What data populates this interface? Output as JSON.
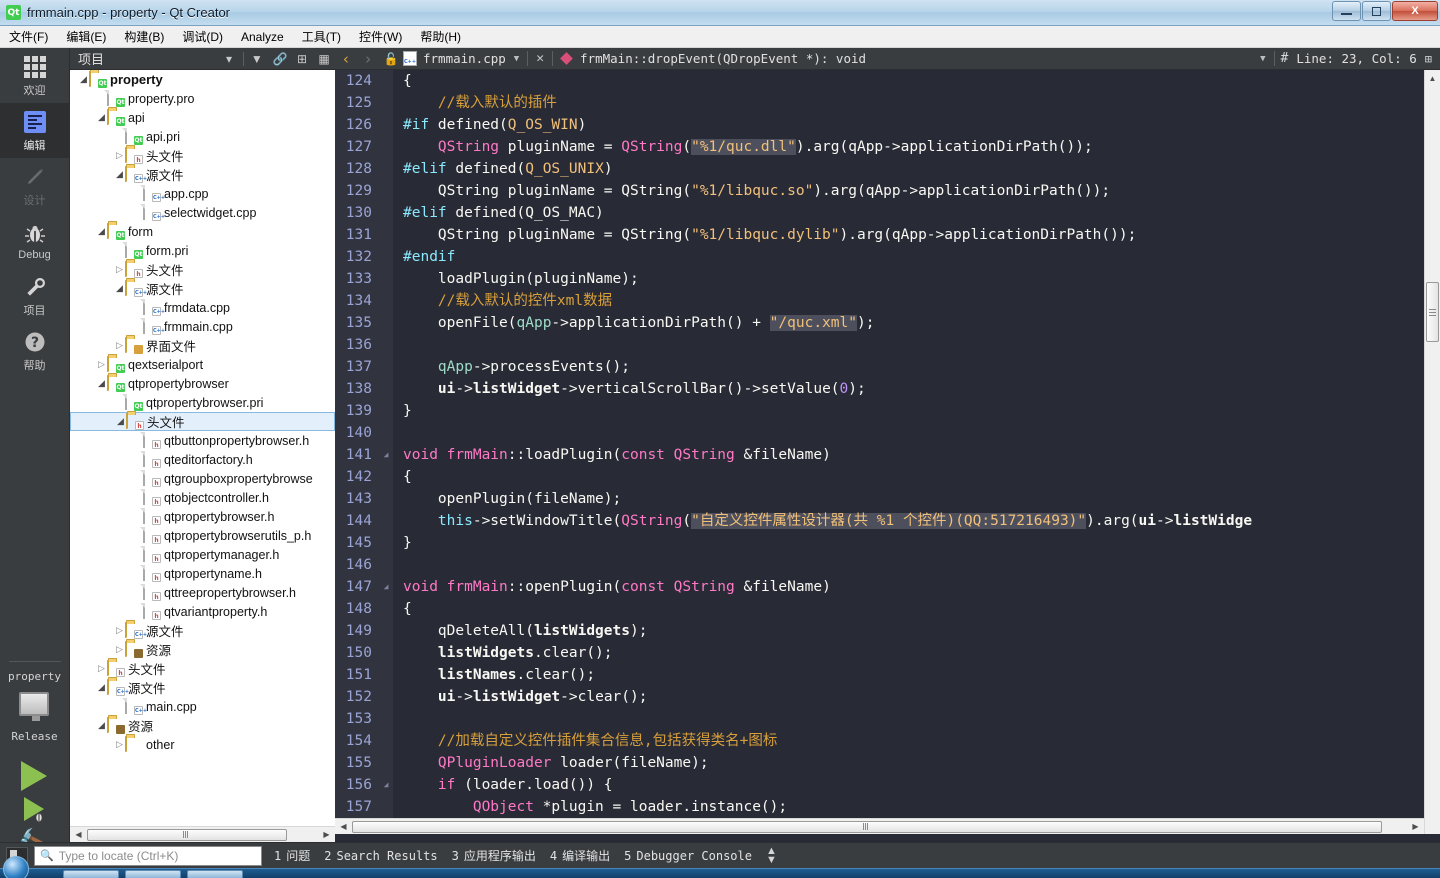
{
  "window": {
    "title": "frmmain.cpp - property - Qt Creator",
    "logo_text": "Qt",
    "minimize_label": "Minimize",
    "maximize_label": "Restore",
    "close_label": "X"
  },
  "menubar": {
    "items": [
      {
        "label": "文件(F)"
      },
      {
        "label": "编辑(E)"
      },
      {
        "label": "构建(B)"
      },
      {
        "label": "调试(D)"
      },
      {
        "label": "Analyze"
      },
      {
        "label": "工具(T)"
      },
      {
        "label": "控件(W)"
      },
      {
        "label": "帮助(H)"
      }
    ]
  },
  "modebar": {
    "modes": [
      {
        "label": "欢迎",
        "icon": "grid-icon",
        "state": "normal"
      },
      {
        "label": "编辑",
        "icon": "document-lines-icon",
        "state": "active"
      },
      {
        "label": "设计",
        "icon": "pencil-icon",
        "state": "disabled"
      },
      {
        "label": "Debug",
        "icon": "bug-icon",
        "state": "normal"
      },
      {
        "label": "项目",
        "icon": "wrench-icon",
        "state": "normal"
      },
      {
        "label": "帮助",
        "icon": "question-mark-icon",
        "state": "normal"
      }
    ],
    "kit": {
      "project": "property",
      "build_config": "Release",
      "run_label": "Run",
      "debug_label": "Start Debugging",
      "build_label": "Build"
    }
  },
  "project_panel": {
    "title": "项目",
    "toolbar": [
      {
        "name": "filter-icon",
        "glyph": "▼"
      },
      {
        "name": "sync-link-icon",
        "glyph": "⎆"
      },
      {
        "name": "split-icon",
        "glyph": "⊞"
      },
      {
        "name": "close-sidebar-icon",
        "glyph": "◧"
      }
    ],
    "tree": [
      {
        "label": "property",
        "depth": 0,
        "arrow": "open",
        "icon": "folder-qt",
        "bold": true
      },
      {
        "label": "property.pro",
        "depth": 1,
        "arrow": "none",
        "icon": "doc-qt"
      },
      {
        "label": "api",
        "depth": 1,
        "arrow": "open",
        "icon": "folder-qt"
      },
      {
        "label": "api.pri",
        "depth": 2,
        "arrow": "none",
        "icon": "doc-qt"
      },
      {
        "label": "头文件",
        "depth": 2,
        "arrow": "closed",
        "icon": "folder-h"
      },
      {
        "label": "源文件",
        "depth": 2,
        "arrow": "open",
        "icon": "folder-cpp"
      },
      {
        "label": "app.cpp",
        "depth": 3,
        "arrow": "none",
        "icon": "doc-cpp"
      },
      {
        "label": "selectwidget.cpp",
        "depth": 3,
        "arrow": "none",
        "icon": "doc-cpp"
      },
      {
        "label": "form",
        "depth": 1,
        "arrow": "open",
        "icon": "folder-qt"
      },
      {
        "label": "form.pri",
        "depth": 2,
        "arrow": "none",
        "icon": "doc-qt"
      },
      {
        "label": "头文件",
        "depth": 2,
        "arrow": "closed",
        "icon": "folder-h"
      },
      {
        "label": "源文件",
        "depth": 2,
        "arrow": "open",
        "icon": "folder-cpp"
      },
      {
        "label": "frmdata.cpp",
        "depth": 3,
        "arrow": "none",
        "icon": "doc-cpp"
      },
      {
        "label": "frmmain.cpp",
        "depth": 3,
        "arrow": "none",
        "icon": "doc-cpp"
      },
      {
        "label": "界面文件",
        "depth": 2,
        "arrow": "closed",
        "icon": "folder-ui"
      },
      {
        "label": "qextserialport",
        "depth": 1,
        "arrow": "closed",
        "icon": "folder-qt"
      },
      {
        "label": "qtpropertybrowser",
        "depth": 1,
        "arrow": "open",
        "icon": "folder-qt"
      },
      {
        "label": "qtpropertybrowser.pri",
        "depth": 2,
        "arrow": "none",
        "icon": "doc-qt"
      },
      {
        "label": "头文件",
        "depth": 2,
        "arrow": "open",
        "icon": "folder-h",
        "selected": true
      },
      {
        "label": "qtbuttonpropertybrowser.h",
        "depth": 3,
        "arrow": "none",
        "icon": "doc-h"
      },
      {
        "label": "qteditorfactory.h",
        "depth": 3,
        "arrow": "none",
        "icon": "doc-h"
      },
      {
        "label": "qtgroupboxpropertybrowse",
        "depth": 3,
        "arrow": "none",
        "icon": "doc-h"
      },
      {
        "label": "qtobjectcontroller.h",
        "depth": 3,
        "arrow": "none",
        "icon": "doc-h"
      },
      {
        "label": "qtpropertybrowser.h",
        "depth": 3,
        "arrow": "none",
        "icon": "doc-h"
      },
      {
        "label": "qtpropertybrowserutils_p.h",
        "depth": 3,
        "arrow": "none",
        "icon": "doc-h"
      },
      {
        "label": "qtpropertymanager.h",
        "depth": 3,
        "arrow": "none",
        "icon": "doc-h"
      },
      {
        "label": "qtpropertyname.h",
        "depth": 3,
        "arrow": "none",
        "icon": "doc-h"
      },
      {
        "label": "qttreepropertybrowser.h",
        "depth": 3,
        "arrow": "none",
        "icon": "doc-h"
      },
      {
        "label": "qtvariantproperty.h",
        "depth": 3,
        "arrow": "none",
        "icon": "doc-h"
      },
      {
        "label": "源文件",
        "depth": 2,
        "arrow": "closed",
        "icon": "folder-cpp"
      },
      {
        "label": "资源",
        "depth": 2,
        "arrow": "closed",
        "icon": "folder-res"
      },
      {
        "label": "头文件",
        "depth": 1,
        "arrow": "closed",
        "icon": "folder-h"
      },
      {
        "label": "源文件",
        "depth": 1,
        "arrow": "open",
        "icon": "folder-cpp"
      },
      {
        "label": "main.cpp",
        "depth": 2,
        "arrow": "none",
        "icon": "doc-cpp"
      },
      {
        "label": "资源",
        "depth": 1,
        "arrow": "open",
        "icon": "folder-res"
      },
      {
        "label": "other",
        "depth": 2,
        "arrow": "closed",
        "icon": "folder-plain"
      }
    ]
  },
  "editor": {
    "toolbar": {
      "back_glyph": "‹",
      "forward_glyph": "›",
      "lock_label": "unlocked",
      "filename": "frmmain.cpp",
      "close_glyph": "✕",
      "symbol": "frmMain::dropEvent(QDropEvent *): void",
      "line_col": "Line: 23, Col: 6",
      "hash_glyph": "#",
      "split_glyph": "⊞"
    },
    "first_line": 124,
    "lines": [
      {
        "n": 124,
        "fold": false,
        "tokens": [
          {
            "t": "{",
            "c": "fn"
          }
        ]
      },
      {
        "n": 125,
        "fold": false,
        "tokens": [
          {
            "t": "    //载入默认的插件",
            "c": "cmt"
          }
        ]
      },
      {
        "n": 126,
        "fold": false,
        "tokens": [
          {
            "t": "#if",
            "c": "pre"
          },
          {
            "t": " defined(",
            "c": "fn"
          },
          {
            "t": "Q_OS_WIN",
            "c": "str"
          },
          {
            "t": ")",
            "c": "fn"
          }
        ]
      },
      {
        "n": 127,
        "fold": false,
        "tokens": [
          {
            "t": "    ",
            "c": "fn"
          },
          {
            "t": "QString",
            "c": "kw"
          },
          {
            "t": " pluginName = ",
            "c": "fn"
          },
          {
            "t": "QString",
            "c": "kw"
          },
          {
            "t": "(",
            "c": "fn"
          },
          {
            "t": "\"%1/quc.dll\"",
            "c": "strh"
          },
          {
            "t": ").arg(qApp->applicationDirPath());",
            "c": "fn"
          }
        ]
      },
      {
        "n": 128,
        "fold": false,
        "tokens": [
          {
            "t": "#elif",
            "c": "pre"
          },
          {
            "t": " defined(",
            "c": "fn"
          },
          {
            "t": "Q_OS_UNIX",
            "c": "str"
          },
          {
            "t": ")",
            "c": "fn"
          }
        ]
      },
      {
        "n": 129,
        "fold": false,
        "tokens": [
          {
            "t": "    QString pluginName = QString(",
            "c": "fn"
          },
          {
            "t": "\"%1/libquc.so\"",
            "c": "str"
          },
          {
            "t": ").arg(qApp->applicationDirPath());",
            "c": "fn"
          }
        ]
      },
      {
        "n": 130,
        "fold": false,
        "tokens": [
          {
            "t": "#elif",
            "c": "pre"
          },
          {
            "t": " defined(Q_OS_MAC)",
            "c": "fn"
          }
        ]
      },
      {
        "n": 131,
        "fold": false,
        "tokens": [
          {
            "t": "    QString pluginName = QString(",
            "c": "fn"
          },
          {
            "t": "\"%1/libquc.dylib\"",
            "c": "str"
          },
          {
            "t": ").arg(qApp->applicationDirPath());",
            "c": "fn"
          }
        ]
      },
      {
        "n": 132,
        "fold": false,
        "tokens": [
          {
            "t": "#endif",
            "c": "pre"
          }
        ]
      },
      {
        "n": 133,
        "fold": false,
        "tokens": [
          {
            "t": "    loadPlugin(pluginName);",
            "c": "fn"
          }
        ]
      },
      {
        "n": 134,
        "fold": false,
        "tokens": [
          {
            "t": "    //载入默认的控件xml数据",
            "c": "cmt"
          }
        ]
      },
      {
        "n": 135,
        "fold": false,
        "tokens": [
          {
            "t": "    openFile(",
            "c": "fn"
          },
          {
            "t": "qApp",
            "c": "var"
          },
          {
            "t": "->applicationDirPath() + ",
            "c": "fn"
          },
          {
            "t": "\"/quc.xml\"",
            "c": "strh"
          },
          {
            "t": ");",
            "c": "fn"
          }
        ]
      },
      {
        "n": 136,
        "fold": false,
        "tokens": []
      },
      {
        "n": 137,
        "fold": false,
        "tokens": [
          {
            "t": "    ",
            "c": "fn"
          },
          {
            "t": "qApp",
            "c": "var"
          },
          {
            "t": "->processEvents();",
            "c": "fn"
          }
        ]
      },
      {
        "n": 138,
        "fold": false,
        "tokens": [
          {
            "t": "    ",
            "c": "fn"
          },
          {
            "t": "ui",
            "c": "bld"
          },
          {
            "t": "->",
            "c": "fn"
          },
          {
            "t": "listWidget",
            "c": "bld"
          },
          {
            "t": "->verticalScrollBar()->setValue(",
            "c": "fn"
          },
          {
            "t": "0",
            "c": "num"
          },
          {
            "t": ");",
            "c": "fn"
          }
        ]
      },
      {
        "n": 139,
        "fold": false,
        "tokens": [
          {
            "t": "}",
            "c": "fn"
          }
        ]
      },
      {
        "n": 140,
        "fold": false,
        "tokens": []
      },
      {
        "n": 141,
        "fold": true,
        "tokens": [
          {
            "t": "void",
            "c": "kw"
          },
          {
            "t": " ",
            "c": "fn"
          },
          {
            "t": "frmMain",
            "c": "kw"
          },
          {
            "t": "::loadPlugin(",
            "c": "fn"
          },
          {
            "t": "const",
            "c": "kw"
          },
          {
            "t": " ",
            "c": "fn"
          },
          {
            "t": "QString",
            "c": "kw"
          },
          {
            "t": " &fileName)",
            "c": "fn"
          }
        ]
      },
      {
        "n": 142,
        "fold": false,
        "tokens": [
          {
            "t": "{",
            "c": "fn"
          }
        ]
      },
      {
        "n": 143,
        "fold": false,
        "tokens": [
          {
            "t": "    openPlugin(fileName);",
            "c": "fn"
          }
        ]
      },
      {
        "n": 144,
        "fold": false,
        "tokens": [
          {
            "t": "    ",
            "c": "fn"
          },
          {
            "t": "this",
            "c": "type"
          },
          {
            "t": "->setWindowTitle(",
            "c": "fn"
          },
          {
            "t": "QString",
            "c": "kw"
          },
          {
            "t": "(",
            "c": "fn"
          },
          {
            "t": "\"自定义控件属性设计器(共 %1 个控件)(QQ:517216493)\"",
            "c": "strh"
          },
          {
            "t": ").arg(",
            "c": "fn"
          },
          {
            "t": "ui",
            "c": "bld"
          },
          {
            "t": "->",
            "c": "fn"
          },
          {
            "t": "listWidge",
            "c": "bld"
          }
        ]
      },
      {
        "n": 145,
        "fold": false,
        "tokens": [
          {
            "t": "}",
            "c": "fn"
          }
        ]
      },
      {
        "n": 146,
        "fold": false,
        "tokens": []
      },
      {
        "n": 147,
        "fold": true,
        "tokens": [
          {
            "t": "void",
            "c": "kw"
          },
          {
            "t": " ",
            "c": "fn"
          },
          {
            "t": "frmMain",
            "c": "kw"
          },
          {
            "t": "::openPlugin(",
            "c": "fn"
          },
          {
            "t": "const",
            "c": "kw"
          },
          {
            "t": " ",
            "c": "fn"
          },
          {
            "t": "QString",
            "c": "kw"
          },
          {
            "t": " &fileName)",
            "c": "fn"
          }
        ]
      },
      {
        "n": 148,
        "fold": false,
        "tokens": [
          {
            "t": "{",
            "c": "fn"
          }
        ]
      },
      {
        "n": 149,
        "fold": false,
        "tokens": [
          {
            "t": "    qDeleteAll(",
            "c": "fn"
          },
          {
            "t": "listWidgets",
            "c": "bld"
          },
          {
            "t": ");",
            "c": "fn"
          }
        ]
      },
      {
        "n": 150,
        "fold": false,
        "tokens": [
          {
            "t": "    ",
            "c": "fn"
          },
          {
            "t": "listWidgets",
            "c": "bld"
          },
          {
            "t": ".clear();",
            "c": "fn"
          }
        ]
      },
      {
        "n": 151,
        "fold": false,
        "tokens": [
          {
            "t": "    ",
            "c": "fn"
          },
          {
            "t": "listNames",
            "c": "bld"
          },
          {
            "t": ".clear();",
            "c": "fn"
          }
        ]
      },
      {
        "n": 152,
        "fold": false,
        "tokens": [
          {
            "t": "    ",
            "c": "fn"
          },
          {
            "t": "ui",
            "c": "bld"
          },
          {
            "t": "->",
            "c": "fn"
          },
          {
            "t": "listWidget",
            "c": "bld"
          },
          {
            "t": "->clear();",
            "c": "fn"
          }
        ]
      },
      {
        "n": 153,
        "fold": false,
        "tokens": []
      },
      {
        "n": 154,
        "fold": false,
        "tokens": [
          {
            "t": "    //加载自定义控件插件集合信息,包括获得类名+图标",
            "c": "cmt"
          }
        ]
      },
      {
        "n": 155,
        "fold": false,
        "tokens": [
          {
            "t": "    ",
            "c": "fn"
          },
          {
            "t": "QPluginLoader",
            "c": "kw"
          },
          {
            "t": " loader(fileName);",
            "c": "fn"
          }
        ]
      },
      {
        "n": 156,
        "fold": true,
        "tokens": [
          {
            "t": "    ",
            "c": "fn"
          },
          {
            "t": "if",
            "c": "kw"
          },
          {
            "t": " (loader.load()) {",
            "c": "fn"
          }
        ]
      },
      {
        "n": 157,
        "fold": false,
        "tokens": [
          {
            "t": "        ",
            "c": "fn"
          },
          {
            "t": "QObject",
            "c": "kw"
          },
          {
            "t": " *plugin = loader.instance();",
            "c": "fn"
          }
        ]
      }
    ]
  },
  "statusbar": {
    "locator_placeholder": "Type to locate (Ctrl+K)",
    "sidebar_toggle_label": "Toggle sidebar",
    "output_panes": [
      {
        "num": "1",
        "label": "问题"
      },
      {
        "num": "2",
        "label": "Search Results"
      },
      {
        "num": "3",
        "label": "应用程序输出"
      },
      {
        "num": "4",
        "label": "编译输出"
      },
      {
        "num": "5",
        "label": "Debugger Console"
      }
    ]
  },
  "colors": {
    "accent_qt_green": "#41cd52",
    "editor_bg": "#282a36",
    "gutter_bg": "#31333f",
    "keyword": "#ff79c6",
    "comment": "#d8a03a",
    "string": "#f1c07a",
    "chrome": "#3a3d40"
  }
}
